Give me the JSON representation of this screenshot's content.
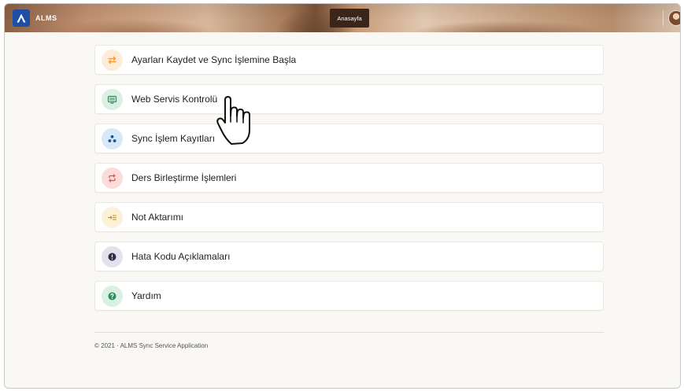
{
  "topbar": {
    "brand_name": "ALMS",
    "nav_home": "Anasayfa"
  },
  "menu": {
    "items": [
      {
        "label": "Ayarları Kaydet ve Sync İşlemine Başla",
        "icon": "transfer-icon",
        "color": "#ef9a3c",
        "bg": "#fdecd9"
      },
      {
        "label": "Web Servis Kontrolü",
        "icon": "monitor-icon",
        "color": "#2e8b5e",
        "bg": "#d9f0e3"
      },
      {
        "label": "Sync İşlem Kayıtları",
        "icon": "nodes-icon",
        "color": "#1d4f97",
        "bg": "#d7e8f8"
      },
      {
        "label": "Ders Birleştirme İşlemleri",
        "icon": "repeat-icon",
        "color": "#d9514c",
        "bg": "#fbdcdb"
      },
      {
        "label": "Not Aktarımı",
        "icon": "import-list-icon",
        "color": "#b88f2d",
        "bg": "#faf1d6"
      },
      {
        "label": "Hata Kodu Açıklamaları",
        "icon": "exclamation-circle-icon",
        "color": "#2e2e46",
        "bg": "#e2e1ec"
      },
      {
        "label": "Yardım",
        "icon": "question-circle-icon",
        "color": "#2e8b5e",
        "bg": "#d9f0e3"
      }
    ]
  },
  "footer": {
    "text": "© 2021 · ALMS Sync Service Application"
  }
}
